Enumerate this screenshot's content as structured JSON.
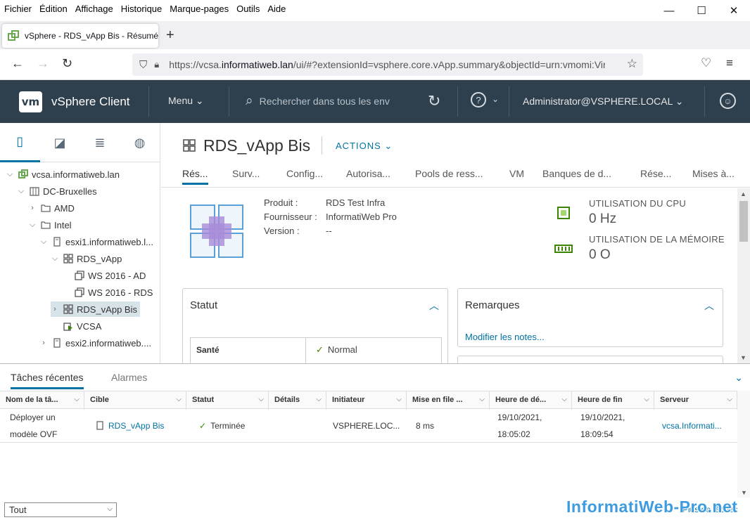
{
  "menubar": {
    "items": [
      {
        "label": "Fichier",
        "key": "F"
      },
      {
        "label": "Édition",
        "key": "É"
      },
      {
        "label": "Affichage",
        "key": "A"
      },
      {
        "label": "Historique",
        "key": "H"
      },
      {
        "label": "Marque-pages",
        "key": "M"
      },
      {
        "label": "Outils",
        "key": "O"
      },
      {
        "label": "Aide",
        "key": "A"
      }
    ]
  },
  "browser": {
    "tab_title": "vSphere - RDS_vApp Bis - Résumé",
    "url_prefix": "https://vcsa.",
    "url_domain": "informatiweb.lan",
    "url_rest": "/ui/#?extensionId=vsphere.core.vApp.summary&objectId=urn:vmomi:VirtualApp"
  },
  "header": {
    "logo": "vm",
    "app_title": "vSphere Client",
    "menu_label": "Menu",
    "search_placeholder": "Rechercher dans tous les env",
    "user": "Administrator@VSPHERE.LOCAL"
  },
  "tree": {
    "root": "vcsa.informatiweb.lan",
    "datacenter": "DC-Bruxelles",
    "folder_amd": "AMD",
    "folder_intel": "Intel",
    "host1": "esxi1.informatiweb.l...",
    "vapp1": "RDS_vApp",
    "vm_ad": "WS 2016 - AD",
    "vm_rds": "WS 2016 - RDS",
    "vapp2": "RDS_vApp Bis",
    "vcsa": "VCSA",
    "host2": "esxi2.informatiweb...."
  },
  "main": {
    "title": "RDS_vApp Bis",
    "actions_label": "ACTIONS",
    "tabs": [
      "Rés...",
      "Surv...",
      "Config...",
      "Autorisa...",
      "Pools de ress...",
      "VM",
      "Banques de d...",
      "Rése...",
      "Mises à..."
    ],
    "product_label": "Produit :",
    "product_value": "RDS Test Infra",
    "vendor_label": "Fournisseur :",
    "vendor_value": "InformatiWeb Pro",
    "version_label": "Version :",
    "version_value": "--",
    "cpu_label": "UTILISATION DU CPU",
    "cpu_value": "0 Hz",
    "mem_label": "UTILISATION DE LA MÉMOIRE",
    "mem_value": "0 O",
    "status_card_title": "Statut",
    "health_label": "Santé",
    "health_value": "Normal",
    "notes_card_title": "Remarques",
    "notes_link": "Modifier les notes..."
  },
  "tasks": {
    "tab_recent": "Tâches récentes",
    "tab_alarms": "Alarmes",
    "columns": [
      "Nom de la tâ...",
      "Cible",
      "Statut",
      "Détails",
      "Initiateur",
      "Mise en file ...",
      "Heure de dé...",
      "Heure de fin",
      "Serveur"
    ],
    "row": {
      "name_line1": "Déployer un",
      "name_line2": "modèle OVF",
      "target": "RDS_vApp Bis",
      "status": "Terminée",
      "initiator": "VSPHERE.LOC...",
      "queued": "8 ms",
      "start_date": "19/10/2021,",
      "start_time": "18:05:02",
      "end_date": "19/10/2021,",
      "end_time": "18:09:54",
      "server": "vcsa.Informati..."
    },
    "filter_value": "Tout",
    "more_tasks": "Plus de tâches"
  },
  "watermark": "InformatiWeb-Pro.net",
  "colors": {
    "header_bg": "#2e3f4d",
    "accent": "#0072a3",
    "success": "#3c8500"
  }
}
